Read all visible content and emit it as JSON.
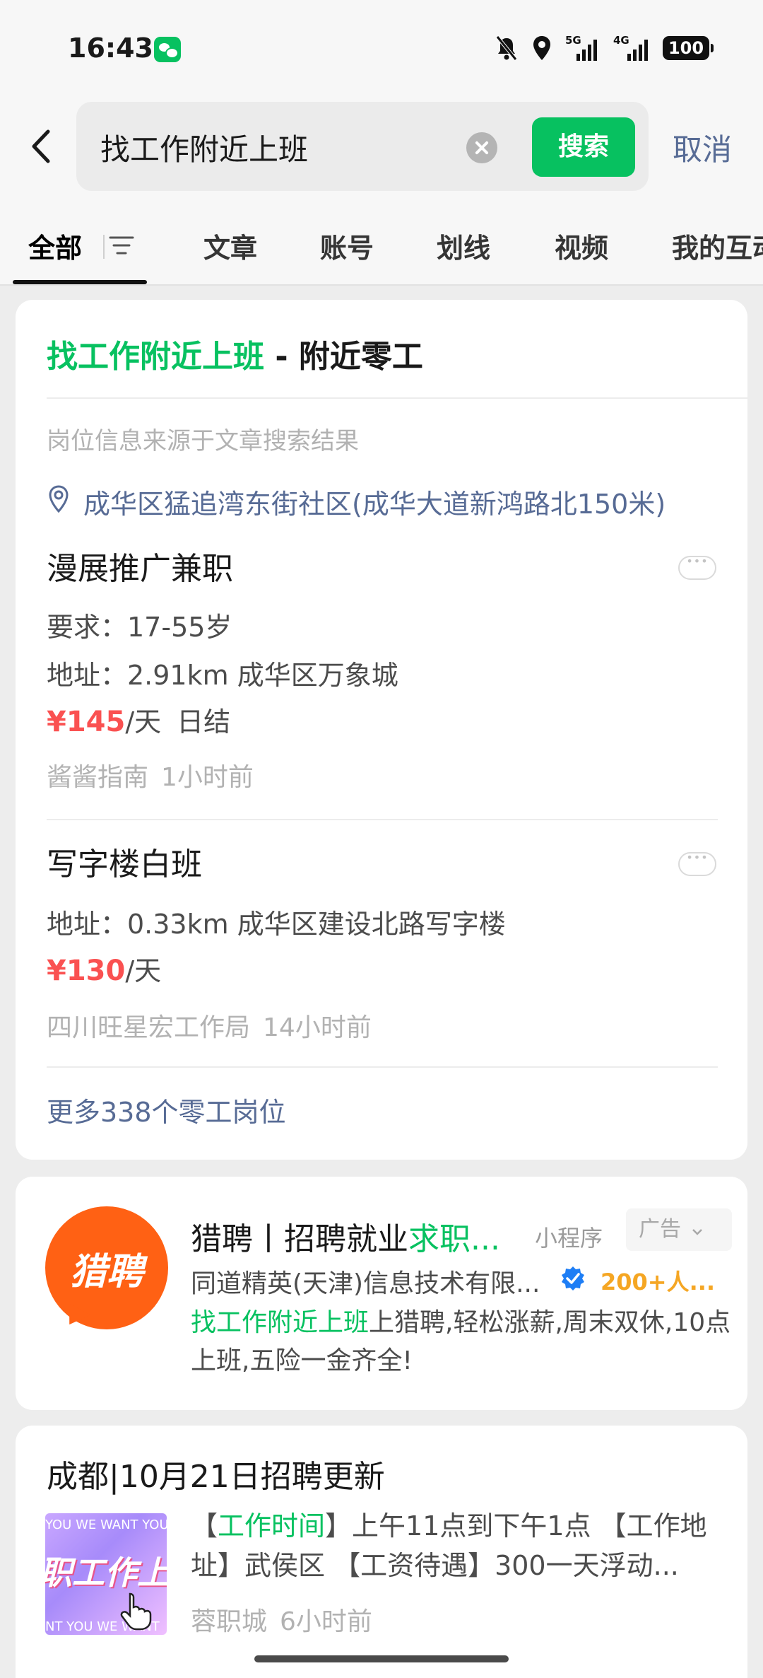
{
  "status_bar": {
    "time": "16:43",
    "network_5g": "5G",
    "network_4g": "4G",
    "battery": "100"
  },
  "search": {
    "query": "找工作附近上班",
    "search_label": "搜索",
    "cancel_label": "取消"
  },
  "tabs": [
    {
      "label": "全部"
    },
    {
      "label": "文章"
    },
    {
      "label": "账号"
    },
    {
      "label": "划线"
    },
    {
      "label": "视频"
    },
    {
      "label": "我的互动"
    }
  ],
  "gig_card": {
    "title_highlight": "找工作附近上班",
    "title_rest": " - 附近零工",
    "source_note": "岗位信息来源于文章搜索结果",
    "location": "成华区猛追湾东街社区(成华大道新鸿路北150米)",
    "jobs": [
      {
        "title": "漫展推广兼职",
        "requirement": "要求：17-55岁",
        "address": "地址：2.91km 成华区万象城",
        "price": "¥145",
        "unit": "/天",
        "settlement": "日结",
        "publisher": "酱酱指南",
        "time_ago": "1小时前"
      },
      {
        "title": "写字楼白班",
        "address": "地址：0.33km 成华区建设北路写字楼",
        "price": "¥130",
        "unit": "/天",
        "publisher": "四川旺星宏工作局",
        "time_ago": "14小时前"
      }
    ],
    "more_label": "更多338个零工岗位"
  },
  "ad_card": {
    "logo_text": "猎聘",
    "title_main": "猎聘丨招聘就业",
    "title_highlight": "求职...",
    "mini_program": "小程序",
    "ad_label": "广告",
    "company": "同道精英(天津)信息技术有限...",
    "count": "200+人...",
    "desc_highlight": "找工作附近上班",
    "desc_rest": "上猎聘,轻松涨薪,周末双休,10点上班,五险一金齐全!"
  },
  "article_card": {
    "title": "成都|10月21日招聘更新",
    "thumb_top": "YOU WE WANT YOU",
    "thumb_big": "职工作上",
    "thumb_bottom": "NT YOU WE WANT",
    "desc_prefix": "【",
    "desc_highlight": "工作时间",
    "desc_rest": "】上午11点到下午1点 【工作地址】武侯区 【工资待遇】300一天浮动...",
    "source": "蓉职城",
    "time_ago": "6小时前"
  }
}
